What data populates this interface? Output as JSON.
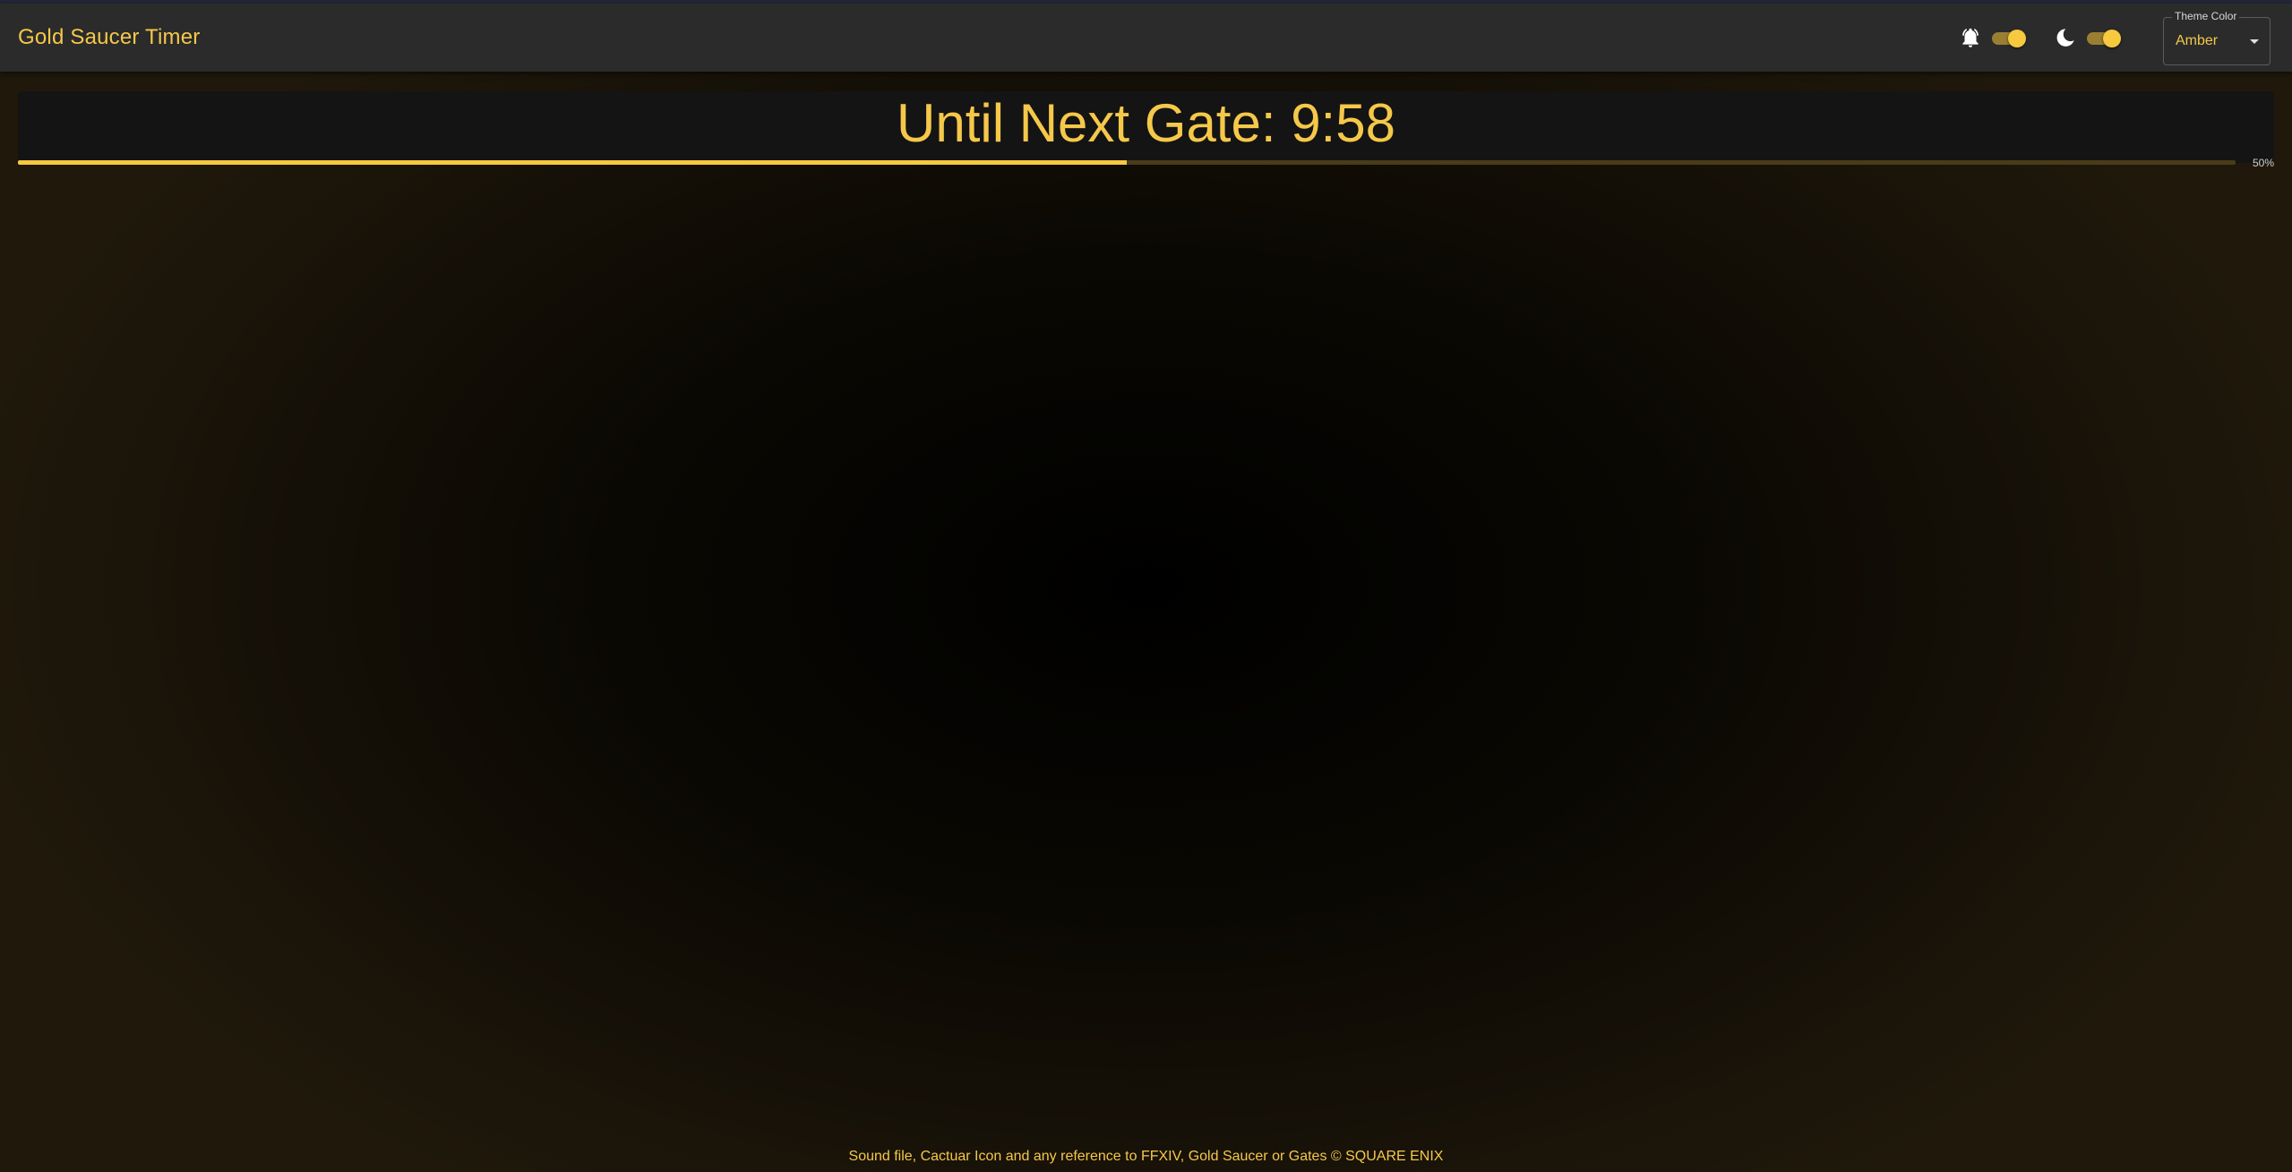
{
  "app": {
    "title": "Gold Saucer Timer"
  },
  "header": {
    "notifications": {
      "icon": "bell-alert-icon",
      "enabled": true
    },
    "dark_mode": {
      "icon": "moon-icon",
      "enabled": true
    },
    "theme_select": {
      "label": "Theme Color",
      "value": "Amber",
      "icon": "caret-down-icon"
    }
  },
  "timer": {
    "text": "Until Next Gate: 9:58",
    "progress_label": "50%",
    "progress_fraction": 0.5
  },
  "footer": {
    "credits": "Sound file, Cactuar Icon and any reference to FFXIV, Gold Saucer or Gates © SQUARE ENIX"
  },
  "colors": {
    "accent": "#f6c93f",
    "text_accent": "#f5c84a",
    "appbar": "#2b2b2b",
    "card": "#141414"
  }
}
